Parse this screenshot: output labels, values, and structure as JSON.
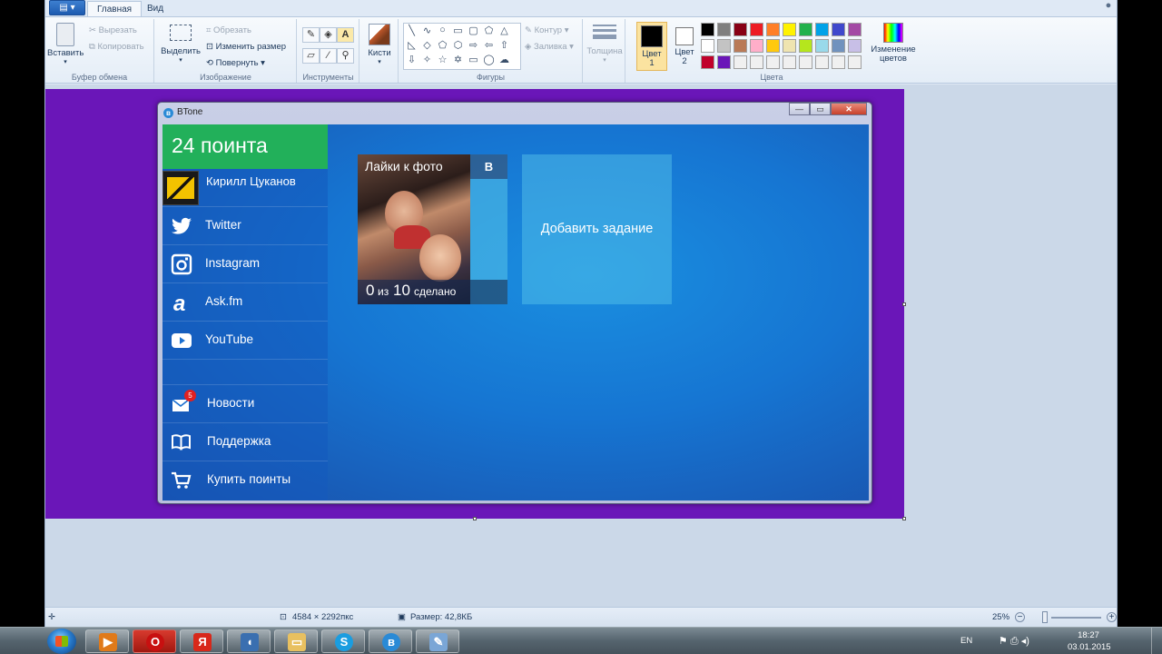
{
  "paint": {
    "tabs": [
      "Главная",
      "Вид"
    ],
    "clipboard": {
      "paste": "Вставить",
      "cut": "Вырезать",
      "copy": "Копировать",
      "label": "Буфер обмена"
    },
    "image": {
      "select": "Выделить",
      "crop": "Обрезать",
      "resize": "Изменить размер",
      "rotate": "Повернуть",
      "label": "Изображение"
    },
    "tools": {
      "label": "Инструменты"
    },
    "brushes": {
      "label": "Кисти"
    },
    "shapes": {
      "outline": "Контур",
      "fill": "Заливка",
      "label": "Фигуры"
    },
    "thickness": "Толщина",
    "color1": "Цвет 1",
    "color2": "Цвет 2",
    "edit_colors": "Изменение цветов",
    "colors_label": "Цвета",
    "palette": [
      "#000000",
      "#7f7f7f",
      "#880015",
      "#ed1c24",
      "#ff7f27",
      "#fff200",
      "#22b14c",
      "#00a2e8",
      "#3f48cc",
      "#a349a4",
      "#ffffff",
      "#c3c3c3",
      "#b97a57",
      "#ffaec9",
      "#ffc90e",
      "#efe4b0",
      "#b5e61d",
      "#99d9ea",
      "#7092be",
      "#c8bfe7",
      "#c0002a",
      "#6a16b8",
      "#f0f0f0",
      "#f0f0f0",
      "#f0f0f0",
      "#f0f0f0",
      "#f0f0f0",
      "#f0f0f0",
      "#f0f0f0",
      "#f0f0f0"
    ],
    "canvas_color": "#6a16b8",
    "status": {
      "dimensions": "4584 × 2292пкс",
      "size": "Размер: 42,8КБ",
      "zoom": "25%"
    }
  },
  "btone": {
    "title": "BTone",
    "points": "24 поинта",
    "user_name": "Кирилл Цуканов",
    "nav": [
      {
        "label": "Twitter",
        "icon": "twitter-icon"
      },
      {
        "label": "Instagram",
        "icon": "instagram-icon"
      },
      {
        "label": "Ask.fm",
        "icon": "askfm-icon"
      },
      {
        "label": "YouTube",
        "icon": "youtube-icon"
      }
    ],
    "bottom_nav": [
      {
        "label": "Новости",
        "icon": "mail-icon",
        "badge": "5"
      },
      {
        "label": "Поддержка",
        "icon": "book-icon"
      },
      {
        "label": "Купить поинты",
        "icon": "cart-icon"
      }
    ],
    "task_tile": {
      "title": "Лайки к фото",
      "network": "В",
      "progress_current": "0",
      "progress_of": "из",
      "progress_total": "10",
      "progress_done": "сделано"
    },
    "add_task": "Добавить задание"
  },
  "taskbar": {
    "lang": "EN",
    "time": "18:27",
    "date": "03.01.2015",
    "apps": [
      "media-player-icon",
      "opera-icon",
      "yandex-icon",
      "audio-icon",
      "explorer-icon",
      "skype-icon",
      "btone-icon",
      "paint-icon"
    ]
  }
}
